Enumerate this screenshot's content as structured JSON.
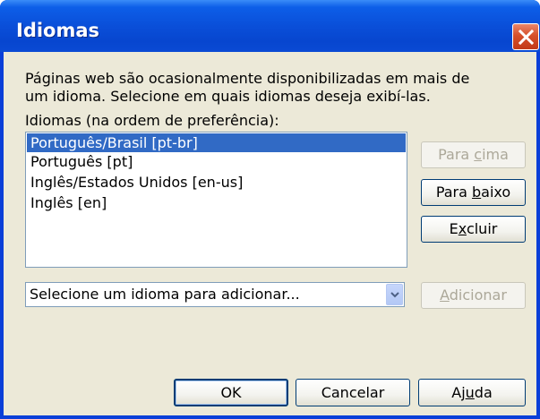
{
  "dialog": {
    "title": "Idiomas",
    "description_line1": "Páginas web são ocasionalmente disponibilizadas em mais de",
    "description_line2": "um idioma. Selecione em quais idiomas deseja exibí-las.",
    "list_label": "Idiomas (na ordem de preferência):"
  },
  "languages": [
    {
      "label": "Português/Brasil  [pt-br]",
      "selected": true
    },
    {
      "label": "Português  [pt]",
      "selected": false
    },
    {
      "label": "Inglês/Estados Unidos  [en-us]",
      "selected": false
    },
    {
      "label": "Inglês  [en]",
      "selected": false
    }
  ],
  "buttons": {
    "move_up": {
      "before": "Para ",
      "key": "c",
      "after": "ima",
      "enabled": false
    },
    "move_down": {
      "before": "Para ",
      "key": "b",
      "after": "aixo",
      "enabled": true
    },
    "remove": {
      "before": "E",
      "key": "x",
      "after": "cluir",
      "enabled": true
    },
    "add": {
      "before": "",
      "key": "A",
      "after": "dicionar",
      "enabled": false
    },
    "ok": "OK",
    "cancel": "Cancelar",
    "help": {
      "before": "Aj",
      "key": "u",
      "after": "da"
    }
  },
  "add_combo": {
    "placeholder": "Selecione um idioma para adicionar..."
  },
  "icons": {
    "close": "close-icon",
    "dropdown": "chevron-down-icon"
  },
  "colors": {
    "titlebar": "#0a4fd9",
    "selection": "#316ac5",
    "dialog_bg": "#ece9d8",
    "close_button": "#d6502a"
  }
}
